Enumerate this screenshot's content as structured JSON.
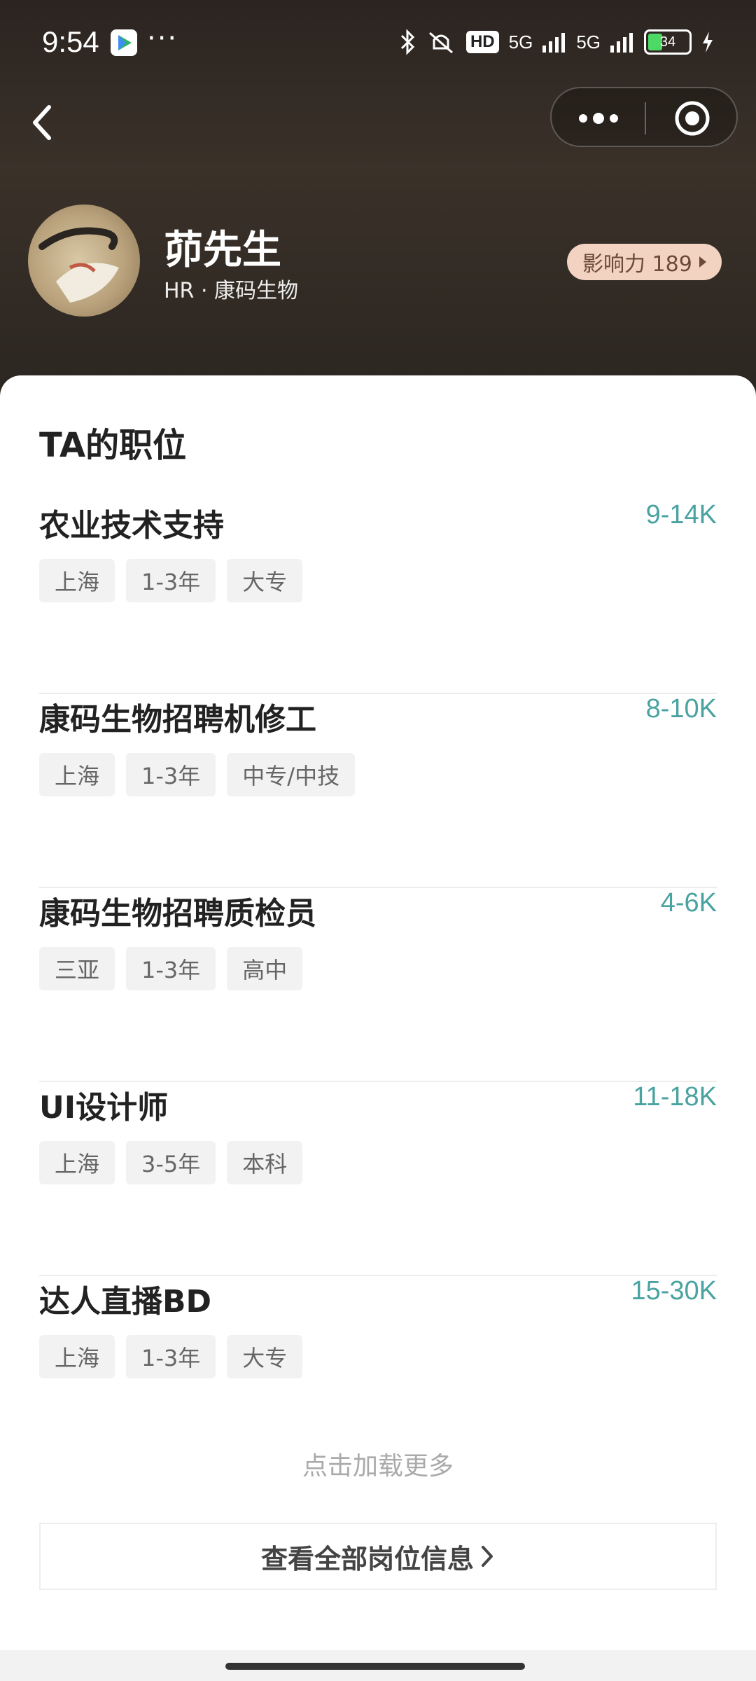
{
  "status": {
    "time": "9:54",
    "dots": "···",
    "hd": "HD",
    "net1": "5G",
    "net2": "5G",
    "battery": "34"
  },
  "profile": {
    "name": "茆先生",
    "subtitle": "HR · 康码生物",
    "influence": "影响力 189"
  },
  "section": {
    "title": "TA的职位"
  },
  "jobs": [
    {
      "title": "农业技术支持",
      "salary": "9-14K",
      "tags": [
        "上海",
        "1-3年",
        "大专"
      ]
    },
    {
      "title": "康码生物招聘机修工",
      "salary": "8-10K",
      "tags": [
        "上海",
        "1-3年",
        "中专/中技"
      ]
    },
    {
      "title": "康码生物招聘质检员",
      "salary": "4-6K",
      "tags": [
        "三亚",
        "1-3年",
        "高中"
      ]
    },
    {
      "title": "UI设计师",
      "salary": "11-18K",
      "tags": [
        "上海",
        "3-5年",
        "本科"
      ]
    },
    {
      "title": "达人直播BD",
      "salary": "15-30K",
      "tags": [
        "上海",
        "1-3年",
        "大专"
      ]
    }
  ],
  "footer": {
    "load_more": "点击加载更多",
    "view_all": "查看全部岗位信息"
  },
  "colors": {
    "salary": "#4aa3a0",
    "influence_bg": "#f2d3c2"
  }
}
